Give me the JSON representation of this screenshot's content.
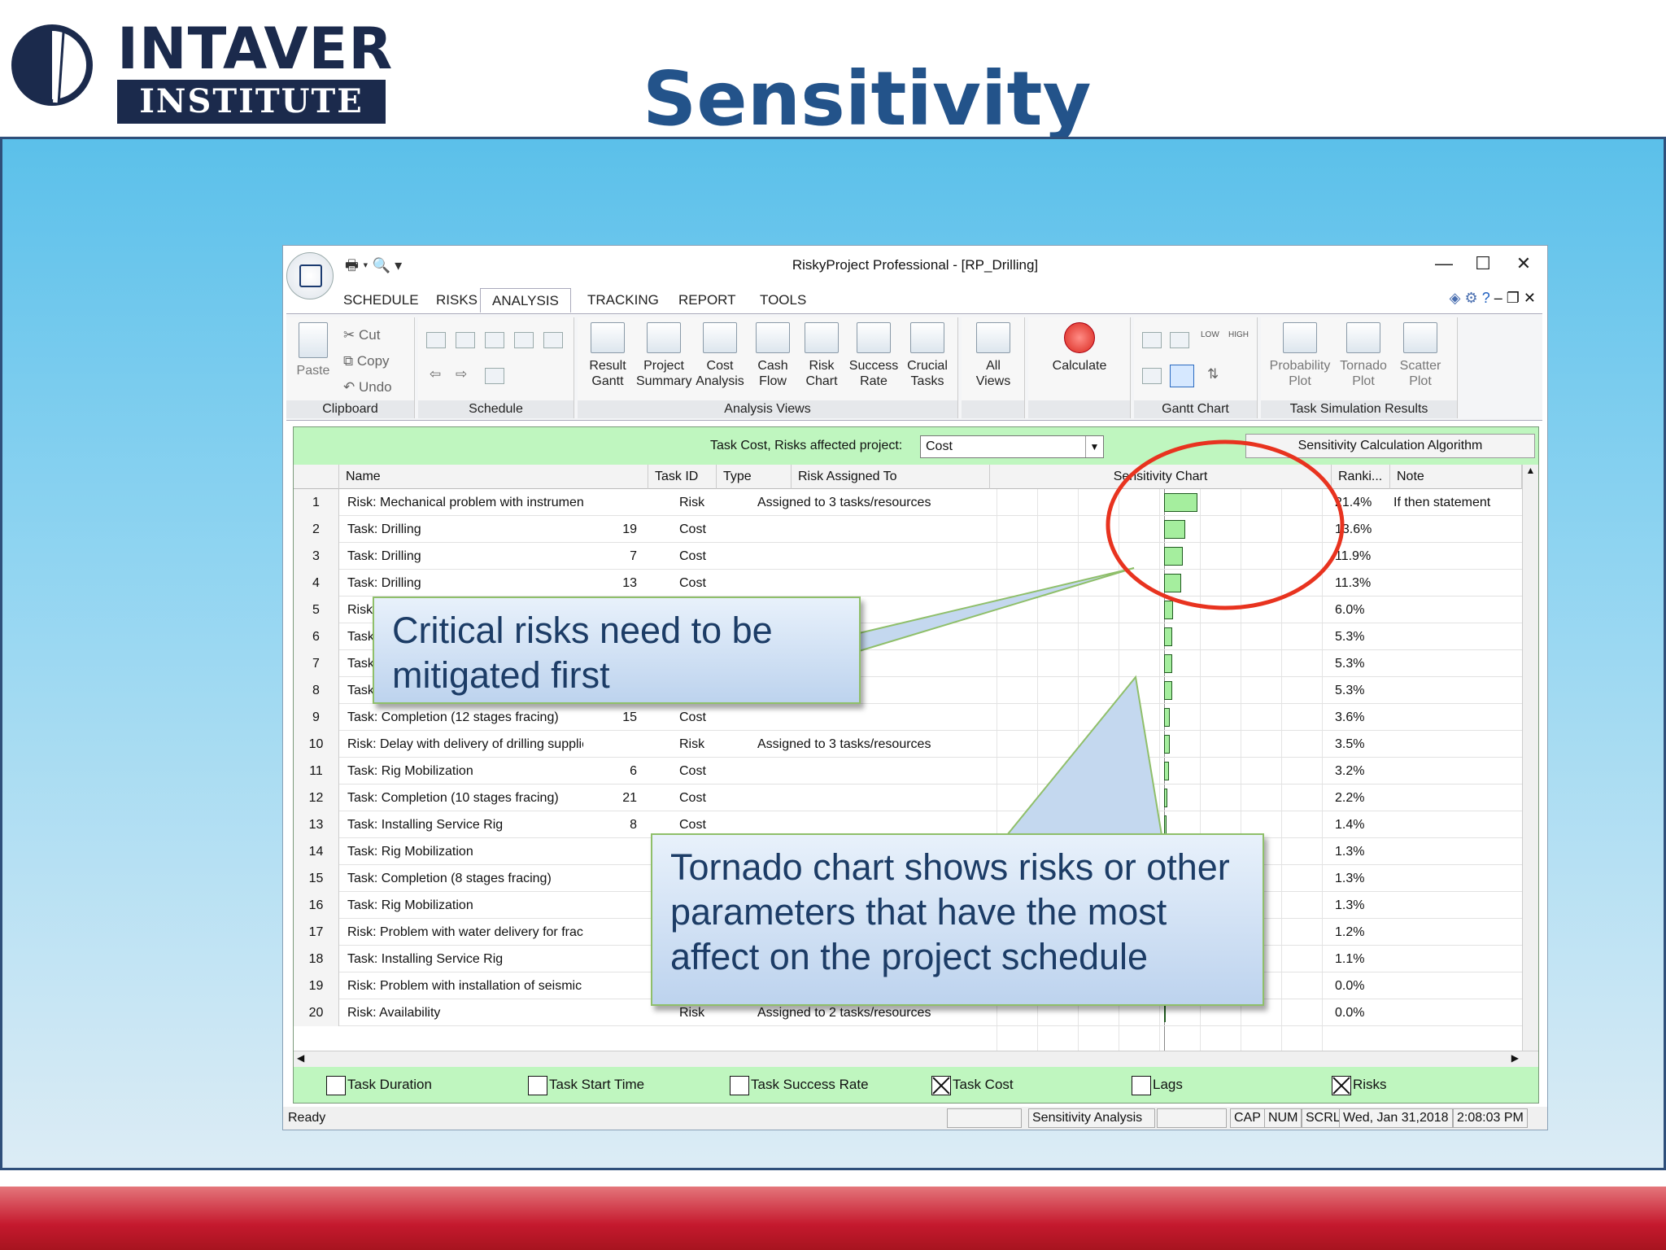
{
  "slide": {
    "logo_line1": "INTAVER",
    "logo_line2": "INSTITUTE",
    "title": "Sensitivity"
  },
  "window": {
    "title": "RiskyProject Professional - [RP_Drilling]",
    "tabs": [
      "SCHEDULE",
      "RISKS",
      "ANALYSIS",
      "TRACKING",
      "REPORT",
      "TOOLS"
    ],
    "active_tab": "ANALYSIS"
  },
  "ribbon": {
    "clipboard": {
      "label": "Clipboard",
      "paste": "Paste",
      "cut": "Cut",
      "copy": "Copy",
      "undo": "Undo"
    },
    "schedule": {
      "label": "Schedule"
    },
    "analysis_views": {
      "label": "Analysis Views",
      "buttons": [
        {
          "l1": "Result",
          "l2": "Gantt"
        },
        {
          "l1": "Project",
          "l2": "Summary"
        },
        {
          "l1": "Cost",
          "l2": "Analysis"
        },
        {
          "l1": "Cash",
          "l2": "Flow"
        },
        {
          "l1": "Risk",
          "l2": "Chart"
        },
        {
          "l1": "Success",
          "l2": "Rate"
        },
        {
          "l1": "Crucial",
          "l2": "Tasks"
        }
      ]
    },
    "all_views": {
      "l1": "All",
      "l2": "Views"
    },
    "calculate": "Calculate",
    "gantt_chart": {
      "label": "Gantt Chart",
      "low": "LOW",
      "high": "HIGH"
    },
    "task_sim": {
      "label": "Task Simulation Results",
      "buttons": [
        {
          "l1": "Probability",
          "l2": "Plot"
        },
        {
          "l1": "Tornado",
          "l2": "Plot"
        },
        {
          "l1": "Scatter",
          "l2": "Plot"
        }
      ]
    }
  },
  "pane": {
    "filter_label": "Task Cost, Risks affected project:",
    "filter_value": "Cost",
    "algo_button": "Sensitivity Calculation Algorithm",
    "columns": {
      "name": "Name",
      "task_id": "Task ID",
      "type": "Type",
      "assigned": "Risk Assigned To",
      "chart": "Sensitivity Chart",
      "rank": "Ranki...",
      "note": "Note"
    },
    "rows": [
      {
        "n": "1",
        "name": "Risk: Mechanical problem with instrument: additional",
        "id": "",
        "type": "Risk",
        "assigned": "Assigned to 3 tasks/resources",
        "rank": "21.4%",
        "value": 21.4,
        "note": "If then statement"
      },
      {
        "n": "2",
        "name": "Task: Drilling",
        "id": "19",
        "type": "Cost",
        "assigned": "",
        "rank": "13.6%",
        "value": 13.6,
        "note": ""
      },
      {
        "n": "3",
        "name": "Task: Drilling",
        "id": "7",
        "type": "Cost",
        "assigned": "",
        "rank": "11.9%",
        "value": 11.9,
        "note": ""
      },
      {
        "n": "4",
        "name": "Task: Drilling",
        "id": "13",
        "type": "Cost",
        "assigned": "",
        "rank": "11.3%",
        "value": 11.3,
        "note": ""
      },
      {
        "n": "5",
        "name": "Risk",
        "id": "",
        "type": "",
        "assigned": "",
        "rank": "6.0%",
        "value": 6.0,
        "note": ""
      },
      {
        "n": "6",
        "name": "Task",
        "id": "",
        "type": "",
        "assigned": "",
        "rank": "5.3%",
        "value": 5.3,
        "note": ""
      },
      {
        "n": "7",
        "name": "Task",
        "id": "",
        "type": "",
        "assigned": "",
        "rank": "5.3%",
        "value": 5.3,
        "note": ""
      },
      {
        "n": "8",
        "name": "Task",
        "id": "",
        "type": "",
        "assigned": "",
        "rank": "5.3%",
        "value": 5.3,
        "note": ""
      },
      {
        "n": "9",
        "name": "Task: Completion (12 stages fracing)",
        "id": "15",
        "type": "Cost",
        "assigned": "",
        "rank": "3.6%",
        "value": 3.6,
        "note": ""
      },
      {
        "n": "10",
        "name": "Risk: Delay with delivery of drilling supplies (mud, et",
        "id": "",
        "type": "Risk",
        "assigned": "Assigned to 3 tasks/resources",
        "rank": "3.5%",
        "value": 3.5,
        "note": ""
      },
      {
        "n": "11",
        "name": "Task: Rig Mobilization",
        "id": "6",
        "type": "Cost",
        "assigned": "",
        "rank": "3.2%",
        "value": 3.2,
        "note": ""
      },
      {
        "n": "12",
        "name": "Task: Completion (10 stages fracing)",
        "id": "21",
        "type": "Cost",
        "assigned": "",
        "rank": "2.2%",
        "value": 2.2,
        "note": ""
      },
      {
        "n": "13",
        "name": "Task: Installing Service Rig",
        "id": "8",
        "type": "Cost",
        "assigned": "",
        "rank": "1.4%",
        "value": 1.4,
        "note": ""
      },
      {
        "n": "14",
        "name": "Task: Rig Mobilization",
        "id": "",
        "type": "",
        "assigned": "",
        "rank": "1.3%",
        "value": 1.3,
        "note": ""
      },
      {
        "n": "15",
        "name": "Task: Completion (8 stages fracing)",
        "id": "",
        "type": "",
        "assigned": "",
        "rank": "1.3%",
        "value": 1.3,
        "note": ""
      },
      {
        "n": "16",
        "name": "Task: Rig Mobilization",
        "id": "",
        "type": "",
        "assigned": "",
        "rank": "1.3%",
        "value": 1.3,
        "note": ""
      },
      {
        "n": "17",
        "name": "Risk: Problem with water delivery for fracturing pro",
        "id": "",
        "type": "",
        "assigned": "",
        "rank": "1.2%",
        "value": 1.2,
        "note": ""
      },
      {
        "n": "18",
        "name": "Task: Installing Service Rig",
        "id": "",
        "type": "",
        "assigned": "",
        "rank": "1.1%",
        "value": 1.1,
        "note": ""
      },
      {
        "n": "19",
        "name": "Risk: Problem with installation of seismic microphone",
        "id": "",
        "type": "",
        "assigned": "",
        "rank": "0.0%",
        "value": 0.0,
        "note": ""
      },
      {
        "n": "20",
        "name": "Risk: Availability",
        "id": "",
        "type": "Risk",
        "assigned": "Assigned to 2 tasks/resources",
        "rank": "0.0%",
        "value": 0.0,
        "note": ""
      }
    ],
    "checkboxes": [
      {
        "label": "Task Duration",
        "checked": false
      },
      {
        "label": "Task Start Time",
        "checked": false
      },
      {
        "label": "Task Success Rate",
        "checked": false
      },
      {
        "label": "Task Cost",
        "checked": true
      },
      {
        "label": "Lags",
        "checked": false
      },
      {
        "label": "Risks",
        "checked": true
      }
    ]
  },
  "status": {
    "ready": "Ready",
    "mode": "Sensitivity Analysis",
    "cap": "CAP",
    "num": "NUM",
    "scrl": "SCRL",
    "date": "Wed, Jan 31,2018",
    "time": "2:08:03 PM"
  },
  "callouts": {
    "critical_l1": "Critical risks need to be",
    "critical_l2": "mitigated first",
    "tornado_l1": "Tornado chart shows risks or other",
    "tornado_l2": "parameters that have the most",
    "tornado_l3": "affect on the project schedule"
  },
  "colors": {
    "title": "#23538a",
    "bar_fill": "#a5ee9e",
    "pane_bg": "#bff6bf",
    "highlight_circle": "#e8331f",
    "red_band": "#c5192e"
  }
}
